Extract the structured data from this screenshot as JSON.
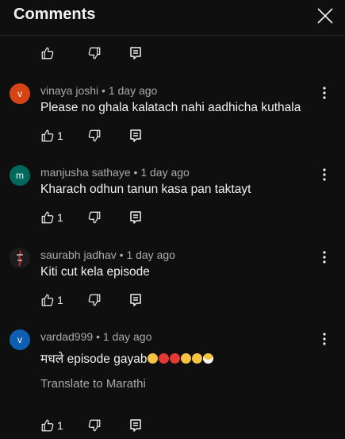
{
  "header": {
    "title": "Comments"
  },
  "comments": [
    {
      "avatar_letter": "v",
      "avatar_color": "#d84315",
      "author": "vinaya joshi",
      "time": "1 day ago",
      "text": "Please no ghala kalatach nahi aadhicha kuthala",
      "likes": "1"
    },
    {
      "avatar_letter": "m",
      "avatar_color": "#00695c",
      "author": "manjusha sathaye",
      "time": "1 day ago",
      "text": "Kharach odhun tanun kasa pan taktayt",
      "likes": "1"
    },
    {
      "avatar_letter": "",
      "avatar_color": "#1c1c1c",
      "author": "saurabh jadhav",
      "time": "1 day ago",
      "text": "Kiti cut kela episode",
      "likes": "1"
    },
    {
      "avatar_letter": "v",
      "avatar_color": "#0d5fb3",
      "author": "vardad999",
      "time": "1 day ago",
      "text": "मधले episode gayab",
      "likes": "1",
      "translate_label": "Translate to Marathi"
    }
  ],
  "meta_separator": "•",
  "icons": {
    "like": "thumbs-up-icon",
    "dislike": "thumbs-down-icon",
    "reply": "reply-icon",
    "more": "more-vert-icon",
    "close": "close-icon"
  },
  "colors": {
    "background": "#0f0f0f",
    "text": "#f1f1f1",
    "secondary": "#aaaaaa"
  }
}
